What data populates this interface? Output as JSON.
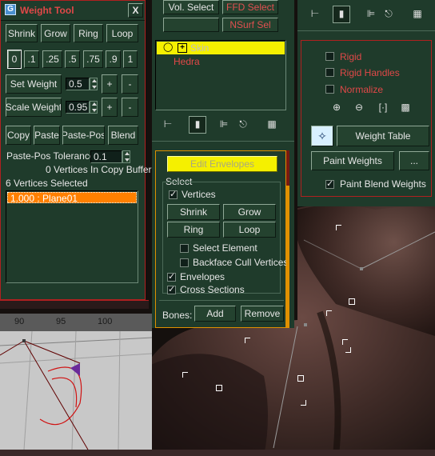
{
  "weight_tool": {
    "title": "Weight  Tool",
    "close": "X",
    "buttons_row1": [
      "Shrink",
      "Grow",
      "Ring",
      "Loop"
    ],
    "presets": [
      "0",
      ".1",
      ".25",
      ".5",
      ".75",
      ".9",
      "1"
    ],
    "set_weight_label": "Set Weight",
    "set_weight_value": "0.5",
    "scale_weight_label": "Scale Weight",
    "scale_weight_value": "0.95",
    "plus": "+",
    "minus": "-",
    "buttons_copy": [
      "Copy",
      "Paste",
      "Paste-Pos",
      "Blend"
    ],
    "tolerance_label": "Paste-Pos Tolerance",
    "tolerance_value": "0.1",
    "copy_buffer_status": "0 Vertices In Copy Buffer",
    "selected_status": "6 Vertices Selected",
    "list_items": [
      "1.000 : Plane01"
    ]
  },
  "middle_panel": {
    "vol_select": "Vol. Select",
    "ffd_select": "FFD Select",
    "nsurf_sel": "NSurf Sel",
    "tree": {
      "skin_label": "Skin",
      "expand_symbol": "+",
      "child_label": "Hedra"
    },
    "toolbar_icons": [
      "pin-icon",
      "modifier-active-icon",
      "show-end-result-icon",
      "make-unique-icon",
      "configure-sets-icon"
    ]
  },
  "envelopes": {
    "edit_envelopes": "Edit Envelopes",
    "select_label": "Select",
    "vertices_label": "Vertices",
    "vertices_checked": true,
    "shrink": "Shrink",
    "grow": "Grow",
    "ring": "Ring",
    "loop": "Loop",
    "select_element_label": "Select Element",
    "select_element_checked": false,
    "backface_label": "Backface Cull Vertices",
    "backface_checked": false,
    "envelopes_label": "Envelopes",
    "envelopes_checked": true,
    "cross_sections_label": "Cross Sections",
    "cross_sections_checked": true,
    "bones_label": "Bones:",
    "add": "Add",
    "remove": "Remove"
  },
  "right_panel": {
    "toolbar_icons": [
      "pin-icon",
      "modifier-active-icon",
      "show-end-result-icon",
      "make-unique-icon",
      "configure-sets-icon"
    ],
    "rigid_label": "Rigid",
    "rigid_handles_label": "Rigid Handles",
    "normalize_label": "Normalize",
    "weight_table": "Weight Table",
    "paint_weights": "Paint Weights",
    "ellipsis": "...",
    "paint_blend_label": "Paint Blend Weights",
    "paint_blend_checked": true
  },
  "viewport": {
    "ruler_labels": [
      "90",
      "95",
      "100"
    ]
  },
  "colors": {
    "panel_bg": "#1f3b2b",
    "accent_yellow": "#f5f000",
    "list_selected": "#ff8000",
    "red_text": "#e04848",
    "border_orange": "#e09000"
  }
}
